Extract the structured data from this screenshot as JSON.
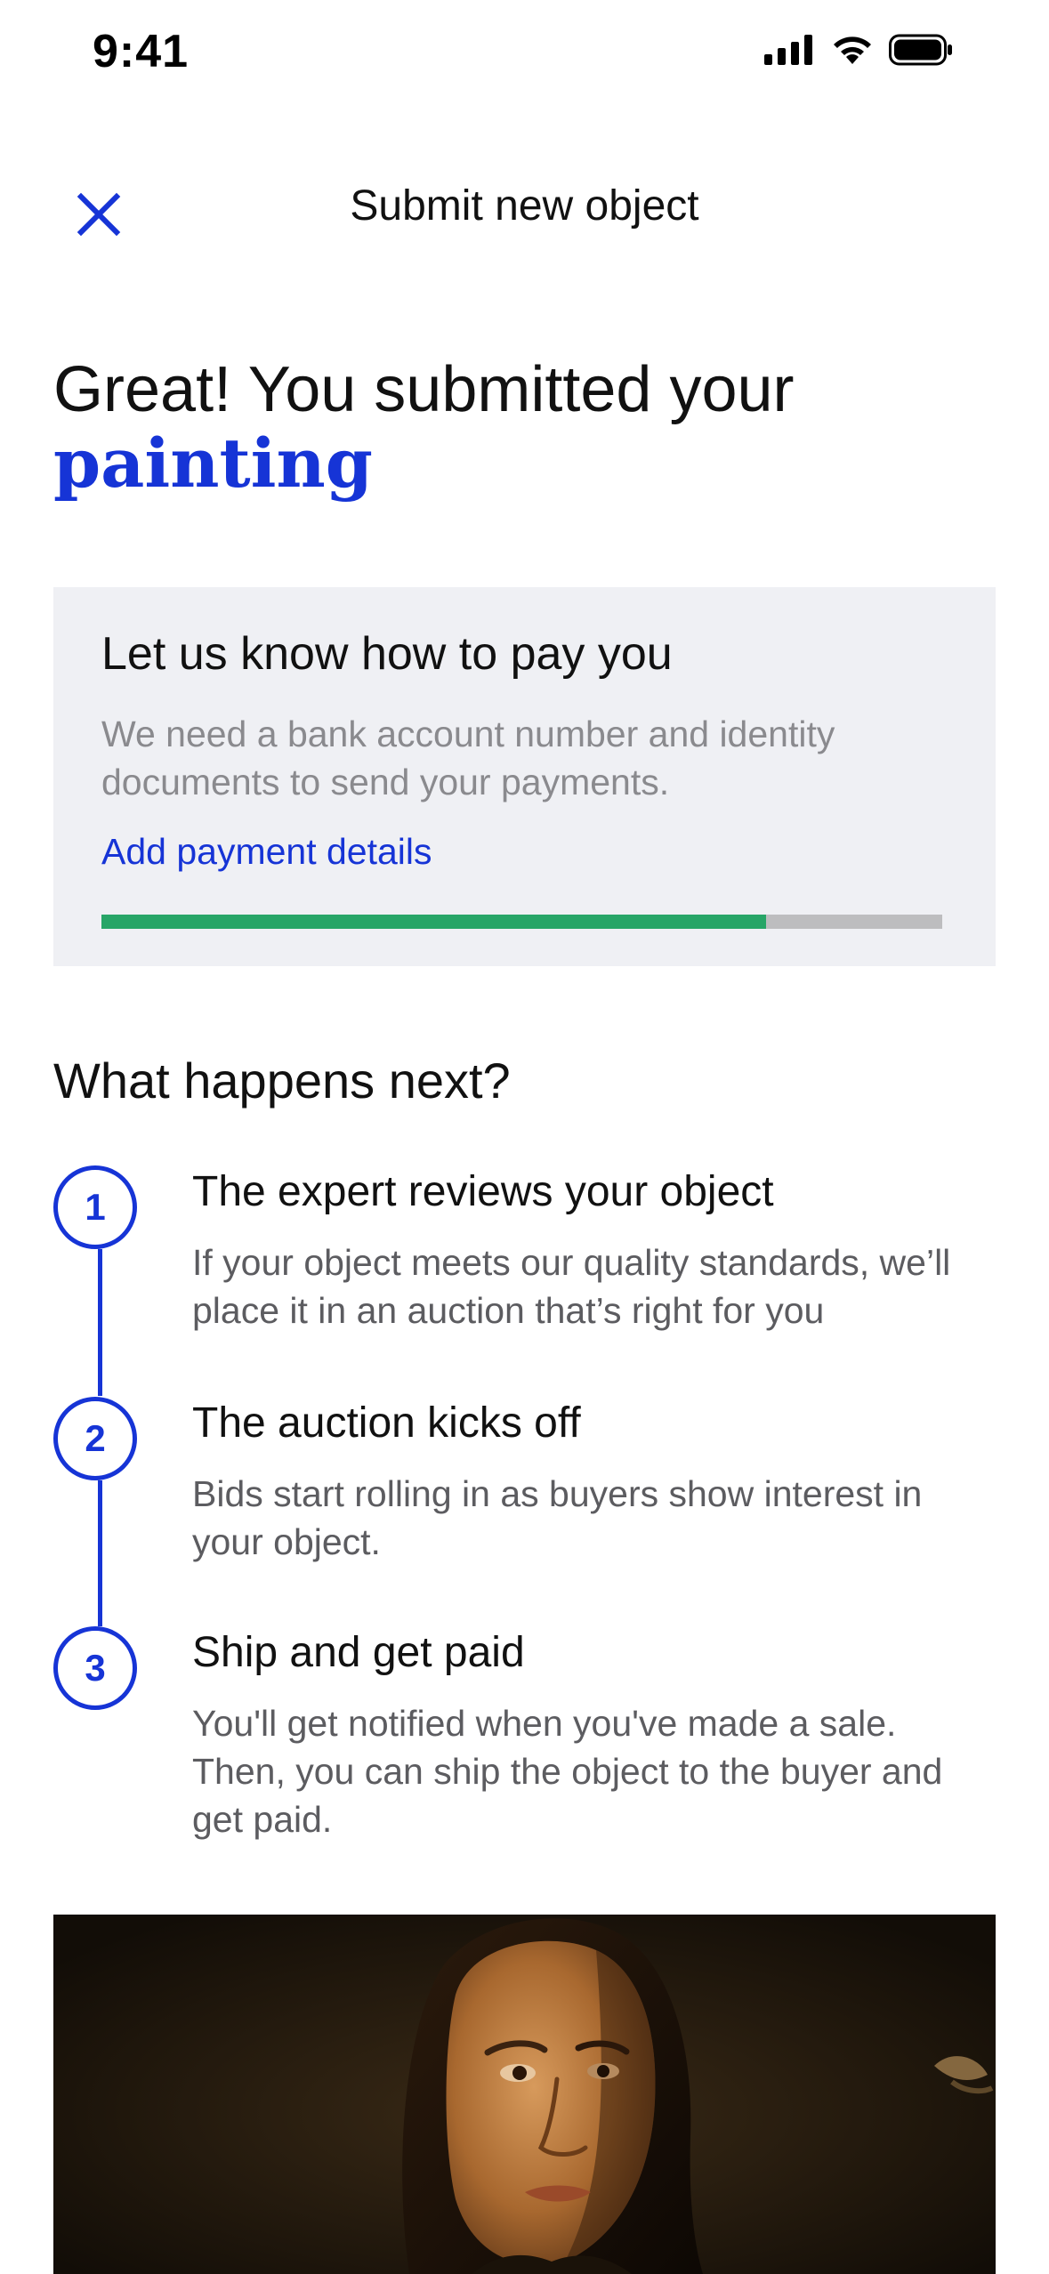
{
  "status_bar": {
    "time": "9:41",
    "icons": [
      "cellular-signal-icon",
      "wifi-icon",
      "battery-icon"
    ]
  },
  "nav": {
    "close_icon": "close-icon",
    "title": "Submit new object"
  },
  "headline": {
    "line1": "Great! You submitted your",
    "highlight": "painting"
  },
  "payment_card": {
    "title": "Let us know how to pay you",
    "description": "We need a bank account number and identity documents to send your payments.",
    "link_label": "Add payment details",
    "progress": 0.79
  },
  "next_section": {
    "heading": "What happens next?",
    "steps": [
      {
        "number": "1",
        "title": "The expert reviews your object",
        "description": "If your object meets our quality standards, we’ll place it in an auction that’s right for you"
      },
      {
        "number": "2",
        "title": "The auction kicks off",
        "description": "Bids start rolling in as buyers show interest in your object."
      },
      {
        "number": "3",
        "title": "Ship and get paid",
        "description": "You'll get notified when you've made a sale. Then, you can ship the object to the buyer and get paid."
      }
    ]
  },
  "image": {
    "subject": "portrait-painting"
  },
  "colors": {
    "accent": "#1634d6",
    "progress_fill": "#27a567",
    "progress_track": "#bdbdbf",
    "card_bg": "#eff0f4",
    "muted_text": "#8a8a8e"
  }
}
